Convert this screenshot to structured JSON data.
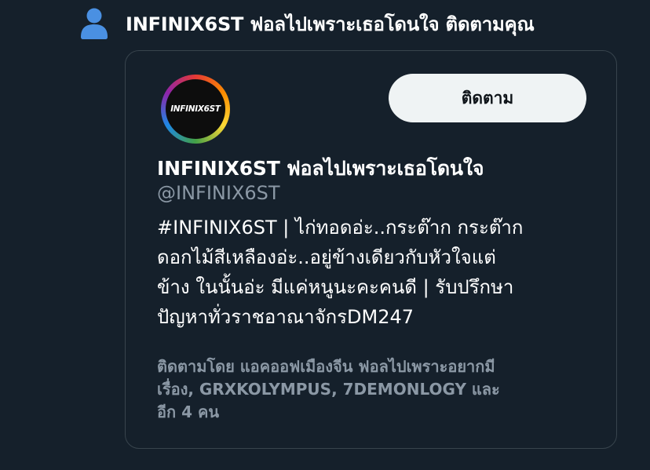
{
  "header": {
    "icon": "person-icon",
    "text": "INFINIX6ST ฟอลไปเพราะเธอโดนใจ ติดตามคุณ"
  },
  "card": {
    "avatar": {
      "label": "INFINIX6ST",
      "ring_colors": [
        "#e53935",
        "#fb8c00",
        "#fdd835",
        "#43a047",
        "#1e88e5",
        "#8e24aa"
      ]
    },
    "follow_button_label": "ติดตาม",
    "display_name": "INFINIX6ST ฟอลไปเพราะเธอโดนใจ",
    "handle": "@INFINIX6ST",
    "bio_lines": [
      "#INFINIX6ST | ไก่ทอดอ่ะ..กระต๊าก กระต๊าก",
      "ดอกไม้สีเหลืองอ่ะ..อยู่ข้างเดียวกับหัวใจแต่",
      "ข้าง ในนั้นอ่ะ มีแค่หนูนะคะคนดี | รับปรึกษา",
      "ปัญหาทั่วราชอาณาจักรDM247"
    ],
    "followed_by_lines": [
      "ติดตามโดย แอคออฟเมืองจีน ฟอลไปเพราะอยากมี",
      "เรื่อง, GRXKOLYMPUS, 7DEMONLOGY และ",
      "อีก 4 คน"
    ]
  },
  "colors": {
    "background": "#15202b",
    "card_border": "#38444d",
    "secondary_text": "#8b98a5",
    "icon_blue": "#4a90e2",
    "button_bg": "#eff3f4"
  }
}
